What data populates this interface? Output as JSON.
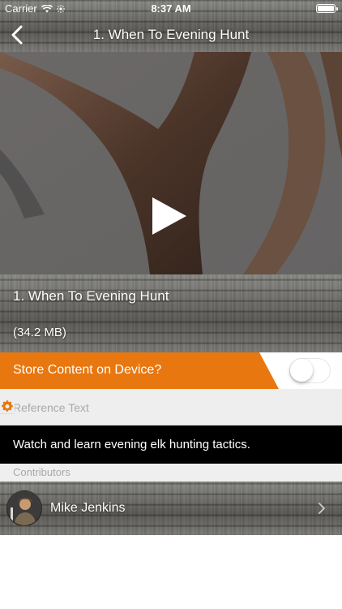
{
  "status_bar": {
    "carrier": "Carrier",
    "time": "8:37 AM"
  },
  "nav": {
    "title": "1. When To Evening Hunt",
    "back_icon": "chevron-left-icon"
  },
  "video": {
    "play_icon": "play-icon"
  },
  "content": {
    "name": "1. When To Evening Hunt",
    "size": "(34.2 MB)"
  },
  "store": {
    "label": "Store Content on Device?",
    "enabled": false,
    "accent_color": "#e8770f"
  },
  "reference": {
    "label": "Reference Text",
    "icon": "gear-icon"
  },
  "description": {
    "text": "Watch and learn evening elk hunting tactics."
  },
  "contributors": {
    "header": "Contributors",
    "items": [
      {
        "name": "Mike Jenkins"
      }
    ]
  }
}
